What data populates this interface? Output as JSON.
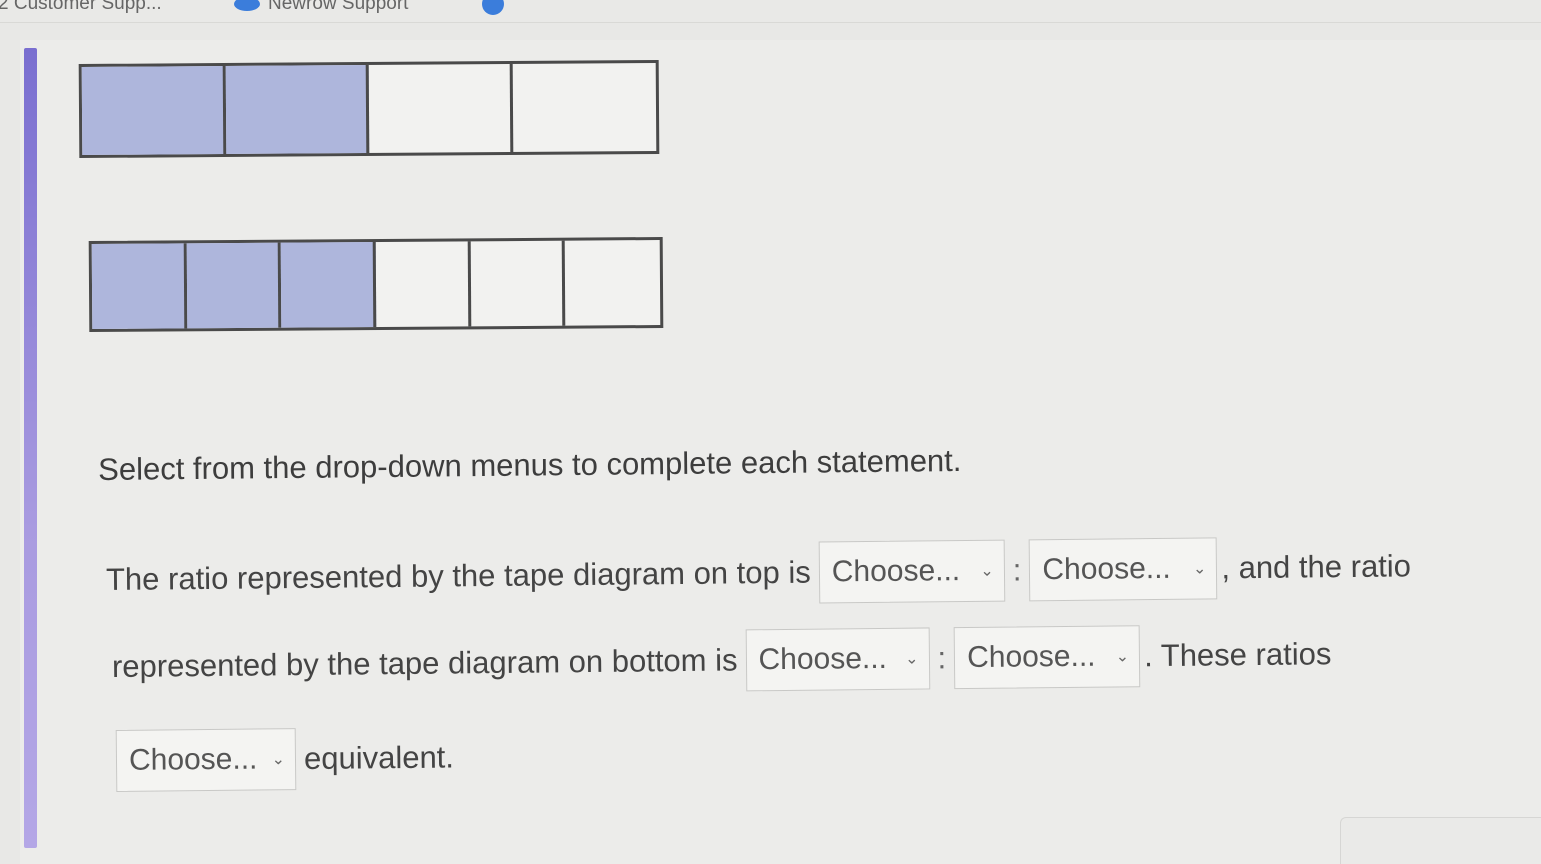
{
  "bookmarks": [
    {
      "label": "2 Customer Supp...",
      "icon": "bookmark-icon"
    },
    {
      "label": "Newrow Support",
      "icon": "cloud-icon"
    },
    {
      "label": "",
      "icon": "globe-icon"
    }
  ],
  "tapes": {
    "top": {
      "total": 4,
      "filled": 2
    },
    "bottom": {
      "total": 6,
      "filled": 3
    }
  },
  "instructions": "Select from the drop-down menus to complete each statement.",
  "statement": {
    "part1": "The ratio represented by the tape diagram on top is",
    "colon": ":",
    "part2": ", and the ratio",
    "part3": "represented by the tape diagram on bottom is",
    "part4": ". These ratios",
    "part5": "equivalent."
  },
  "dropdowns": {
    "top_first": "Choose...",
    "top_second": "Choose...",
    "bottom_first": "Choose...",
    "bottom_second": "Choose...",
    "equivalence": "Choose..."
  },
  "colors": {
    "filled_cell": "#aeb6dc",
    "accent_bar": "#8b7fd8"
  }
}
